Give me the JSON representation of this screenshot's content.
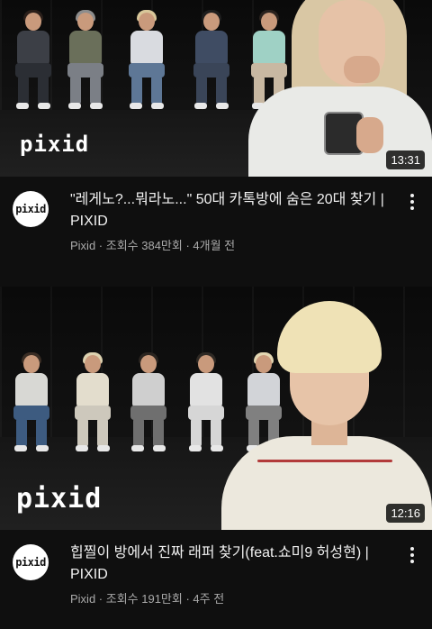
{
  "videos": [
    {
      "duration": "13:31",
      "watermark": "pixid",
      "title": "\"레게노?...뭐라노...\" 50대 카톡방에 숨은 20대 찾기 | PIXID",
      "channel": "Pixid",
      "views": "조회수 384만회",
      "age": "4개월 전",
      "avatar_text": "pixid",
      "menu_icon": "more-vert-icon"
    },
    {
      "duration": "12:16",
      "watermark": "pixid",
      "title": "힙찔이 방에서 진짜 래퍼 찾기(feat.쇼미9 허성현)  | PIXID",
      "channel": "Pixid",
      "views": "조회수 191만회",
      "age": "4주 전",
      "avatar_text": "pixid",
      "menu_icon": "more-vert-icon"
    }
  ],
  "meta_separator": " · "
}
